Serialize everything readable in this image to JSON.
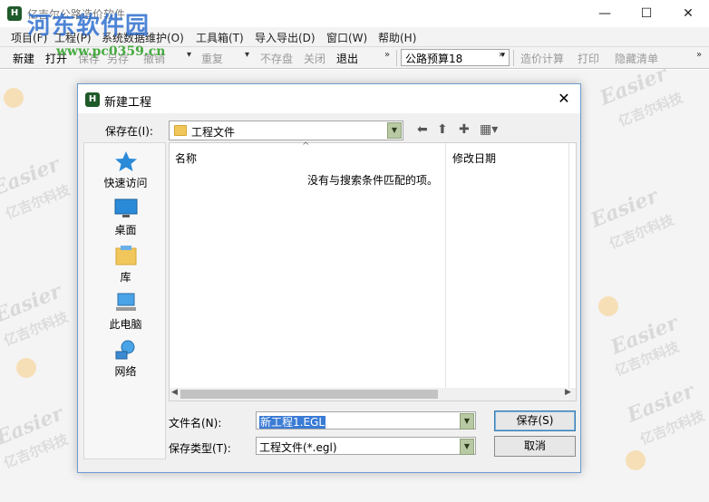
{
  "app": {
    "title": "亿吉尔公路造价软件",
    "icon": "H",
    "window_buttons": {
      "minimize": "—",
      "maximize": "☐",
      "close": "✕"
    }
  },
  "overlay": {
    "site_name": "河东软件园",
    "site_url": "www.pc0359.cn"
  },
  "menu": [
    {
      "label": "项目(F)"
    },
    {
      "label": "工程(P)"
    },
    {
      "label": "系统数据维护(O)"
    },
    {
      "label": "工具箱(T)"
    },
    {
      "label": "导入导出(D)"
    },
    {
      "label": "窗口(W)"
    },
    {
      "label": "帮助(H)"
    }
  ],
  "toolbar": {
    "new": "新建",
    "open": "打开",
    "save": "保存",
    "save_as": "另存",
    "undo": "撤销",
    "redo": "重复",
    "no_save": "不存盘",
    "close": "关闭",
    "exit": "退出",
    "budget_combo": "公路预算18",
    "calc": "造价计算",
    "print": "打印",
    "hide_list": "隐藏清单"
  },
  "background_watermark": {
    "brand_en": "Easier",
    "brand_cn": "亿吉尔科技"
  },
  "dialog": {
    "title": "新建工程",
    "close_glyph": "✕",
    "save_in_label": "保存在(I):",
    "save_in_value": "工程文件",
    "places": [
      {
        "label": "快速访问",
        "icon": "star-icon"
      },
      {
        "label": "桌面",
        "icon": "desktop-icon"
      },
      {
        "label": "库",
        "icon": "library-icon"
      },
      {
        "label": "此电脑",
        "icon": "computer-icon"
      },
      {
        "label": "网络",
        "icon": "network-icon"
      }
    ],
    "columns": {
      "name": "名称",
      "modified": "修改日期"
    },
    "empty_message": "没有与搜索条件匹配的项。",
    "file_name_label": "文件名(N):",
    "file_name_value": "新工程1.EGL",
    "file_type_label": "保存类型(T):",
    "file_type_value": "工程文件(*.egl)",
    "save_button": "保存(S)",
    "cancel_button": "取消"
  }
}
